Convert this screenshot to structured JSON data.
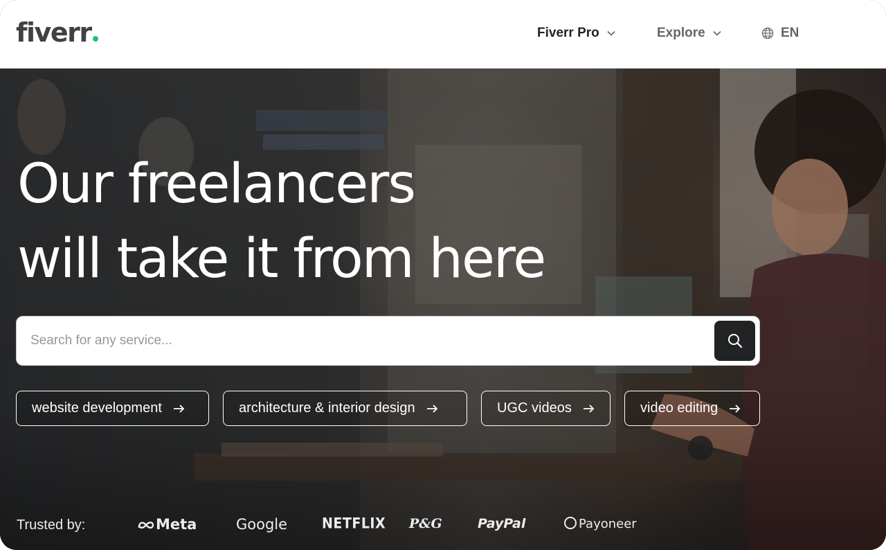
{
  "header": {
    "logo": "fiverr",
    "logo_dot_color": "#1dbf73",
    "nav": {
      "fiverr_pro": "Fiverr Pro",
      "explore": "Explore",
      "language": "EN"
    }
  },
  "hero": {
    "headline_line1": "Our freelancers",
    "headline_line2": "will take it from here",
    "search": {
      "placeholder": "Search for any service...",
      "value": "",
      "button_icon": "search-icon"
    },
    "chips": [
      {
        "label": "website development",
        "icon": "arrow-right-icon"
      },
      {
        "label": "architecture & interior design",
        "icon": "arrow-right-icon"
      },
      {
        "label": "UGC videos",
        "icon": "arrow-right-icon"
      },
      {
        "label": "video editing",
        "icon": "arrow-right-icon"
      }
    ],
    "trusted_by": {
      "label": "Trusted by:",
      "brands": [
        "Meta",
        "Google",
        "NETFLIX",
        "P&G",
        "PayPal",
        "Payoneer"
      ]
    }
  },
  "colors": {
    "brand_green": "#1dbf73",
    "text_dark": "#222325",
    "text_muted": "#62646a",
    "search_button": "#222325"
  }
}
